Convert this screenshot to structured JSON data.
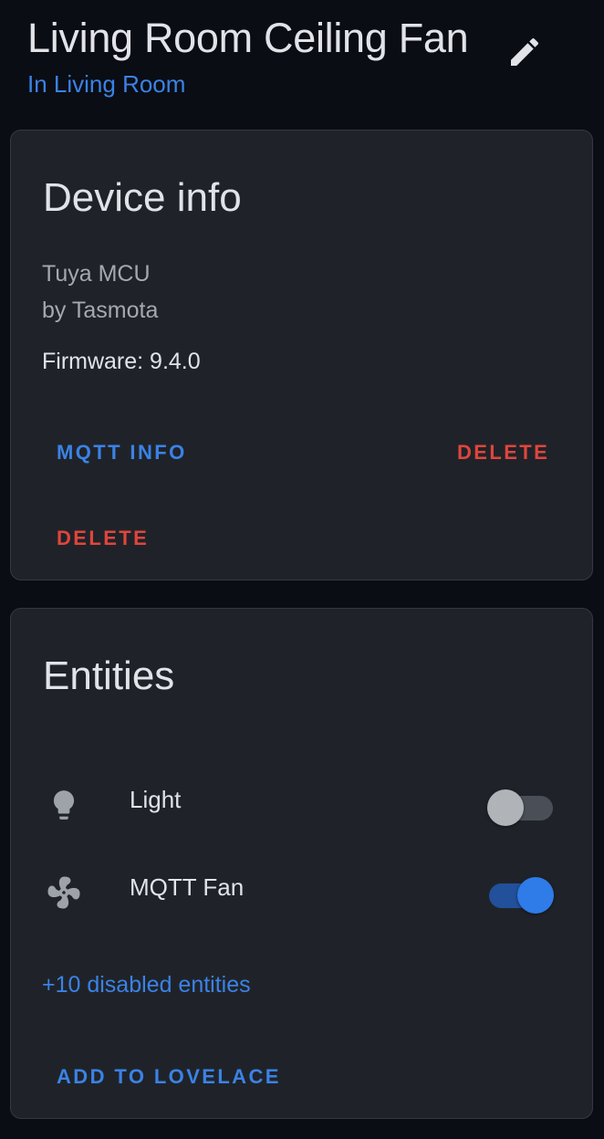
{
  "header": {
    "title": "Living Room Ceiling Fan",
    "area_link": "In Living Room",
    "edit_icon": "pencil-icon"
  },
  "device_info": {
    "title": "Device info",
    "model": "Tuya MCU",
    "manufacturer": "by Tasmota",
    "firmware": "Firmware: 9.4.0",
    "buttons": {
      "mqtt_info": "MQTT INFO",
      "delete_primary": "DELETE",
      "delete_secondary": "DELETE"
    }
  },
  "entities": {
    "title": "Entities",
    "items": [
      {
        "label": "Light",
        "icon": "lightbulb-icon",
        "state": "off"
      },
      {
        "label": "MQTT Fan",
        "icon": "fan-icon",
        "state": "on"
      }
    ],
    "disabled_link": "+10 disabled entities",
    "add_button": "ADD TO LOVELACE"
  },
  "colors": {
    "background": "#0a0d14",
    "card": "#1f2329",
    "primary": "#3b82e6",
    "danger": "#e0453c",
    "text_primary": "#e1e3e8",
    "text_secondary": "#a4a9b1"
  }
}
